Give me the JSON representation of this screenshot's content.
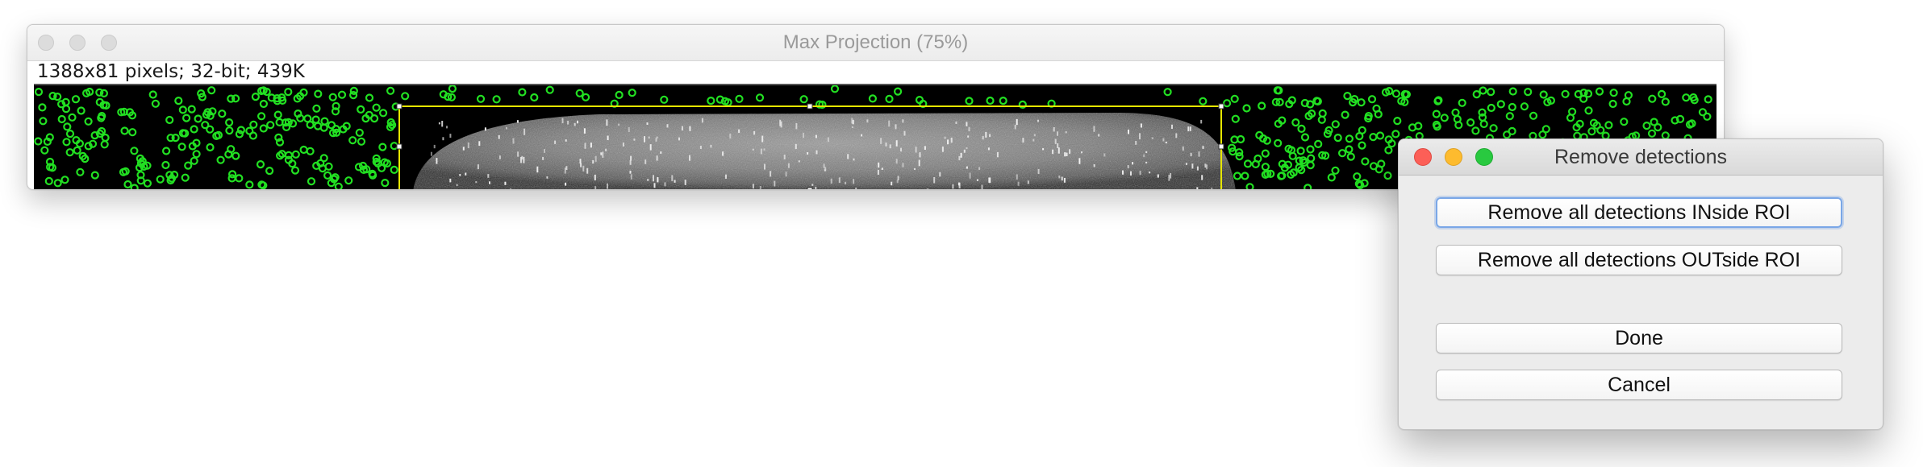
{
  "image_window": {
    "title": "Max Projection (75%)",
    "info": "1388x81 pixels; 32-bit; 439K",
    "colors": {
      "detection": "#22e022",
      "roi": "#e6e600",
      "background": "#000000"
    },
    "icons": {
      "close": "traffic-light-inactive",
      "minimize": "traffic-light-inactive",
      "zoom": "traffic-light-inactive"
    }
  },
  "dialog": {
    "title": "Remove detections",
    "buttons": {
      "remove_inside": "Remove all detections INside ROI",
      "remove_outside": "Remove all detections OUTside ROI",
      "done": "Done",
      "cancel": "Cancel"
    },
    "colors": {
      "close": "#fc5f57",
      "minimize": "#fdbb2e",
      "zoom": "#29c940",
      "focus_ring": "#7aa7e7"
    }
  }
}
